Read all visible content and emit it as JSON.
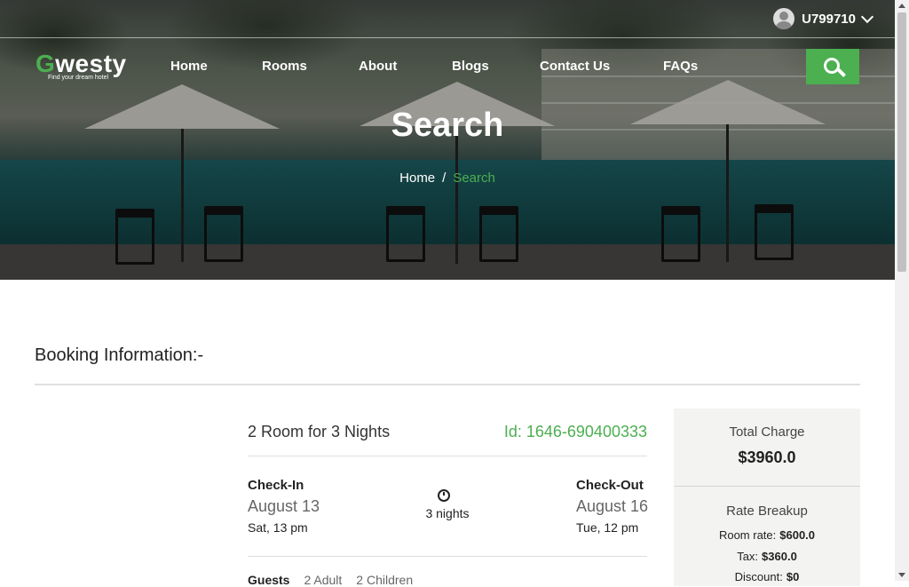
{
  "header": {
    "username": "U799710",
    "logo": {
      "name_first": "G",
      "name_rest": "westy",
      "tagline": "Find your dream hotel"
    },
    "nav": [
      "Home",
      "Rooms",
      "About",
      "Blogs",
      "Contact Us",
      "FAQs"
    ]
  },
  "hero": {
    "title": "Search",
    "breadcrumb": {
      "home": "Home",
      "separator": "/",
      "current": "Search"
    }
  },
  "booking": {
    "section_title": "Booking Information:-",
    "summary": "2 Room for 3 Nights",
    "id": "Id: 1646-690400333",
    "checkin": {
      "label": "Check-In",
      "date": "August 13",
      "time": "Sat, 13 pm"
    },
    "duration": "3 nights",
    "checkout": {
      "label": "Check-Out",
      "date": "August 16",
      "time": "Tue, 12 pm"
    },
    "guests": {
      "label": "Guests",
      "adults": "2 Adult",
      "children": "2 Children"
    }
  },
  "pricing": {
    "total_label": "Total Charge",
    "total_value": "$3960.0",
    "breakup_label": "Rate Breakup",
    "room_rate_label": "Room rate:",
    "room_rate": "$600.0",
    "tax_label": "Tax:",
    "tax": "$360.0",
    "discount_label": "Discount:",
    "discount": "$0"
  },
  "colors": {
    "accent": "#4caf50",
    "panel_bg": "#f3f4f2"
  }
}
